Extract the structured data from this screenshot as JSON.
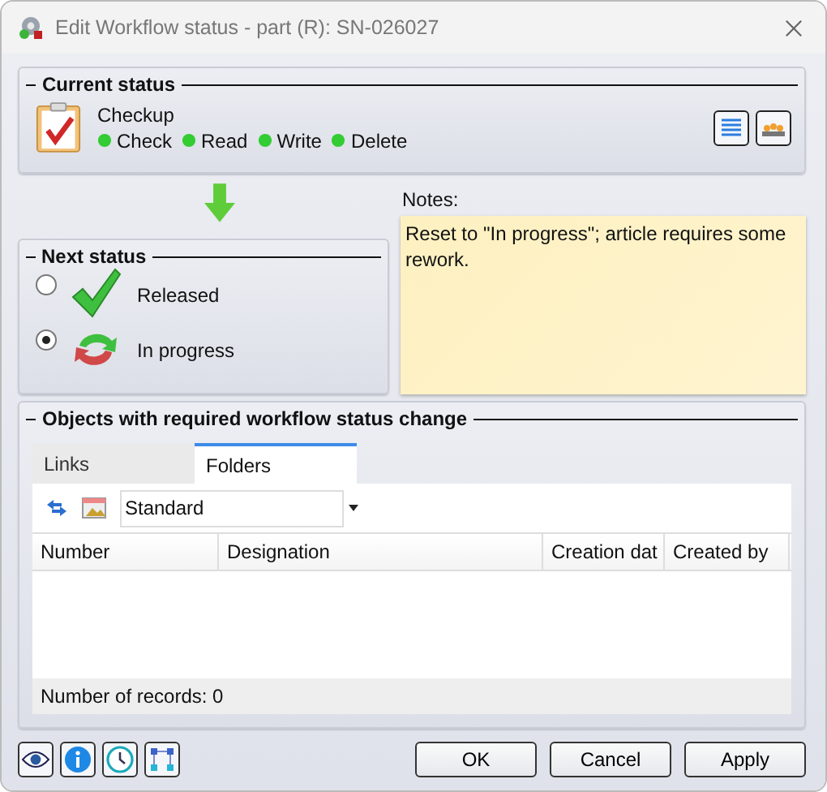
{
  "window": {
    "title": "Edit Workflow status - part (R): SN-026027"
  },
  "current_status": {
    "heading": "Current status",
    "name": "Checkup",
    "rights": [
      "Check",
      "Read",
      "Write",
      "Delete"
    ]
  },
  "next_status": {
    "heading": "Next status",
    "options": [
      {
        "label": "Released",
        "kind": "released",
        "selected": false
      },
      {
        "label": "In progress",
        "kind": "progress",
        "selected": true
      }
    ]
  },
  "notes": {
    "label": "Notes:",
    "value": "Reset to \"In progress\"; article requires some rework."
  },
  "objects": {
    "heading": "Objects with required workflow status change",
    "tabs": [
      {
        "label": "Links",
        "selected": false
      },
      {
        "label": "Folders",
        "selected": true
      }
    ],
    "view": {
      "value": "Standard"
    },
    "table": {
      "columns": [
        "Number",
        "Designation",
        "Creation dat",
        "Created by"
      ]
    },
    "record_count": "Number of records: 0"
  },
  "buttons": [
    "OK",
    "Cancel",
    "Apply"
  ]
}
